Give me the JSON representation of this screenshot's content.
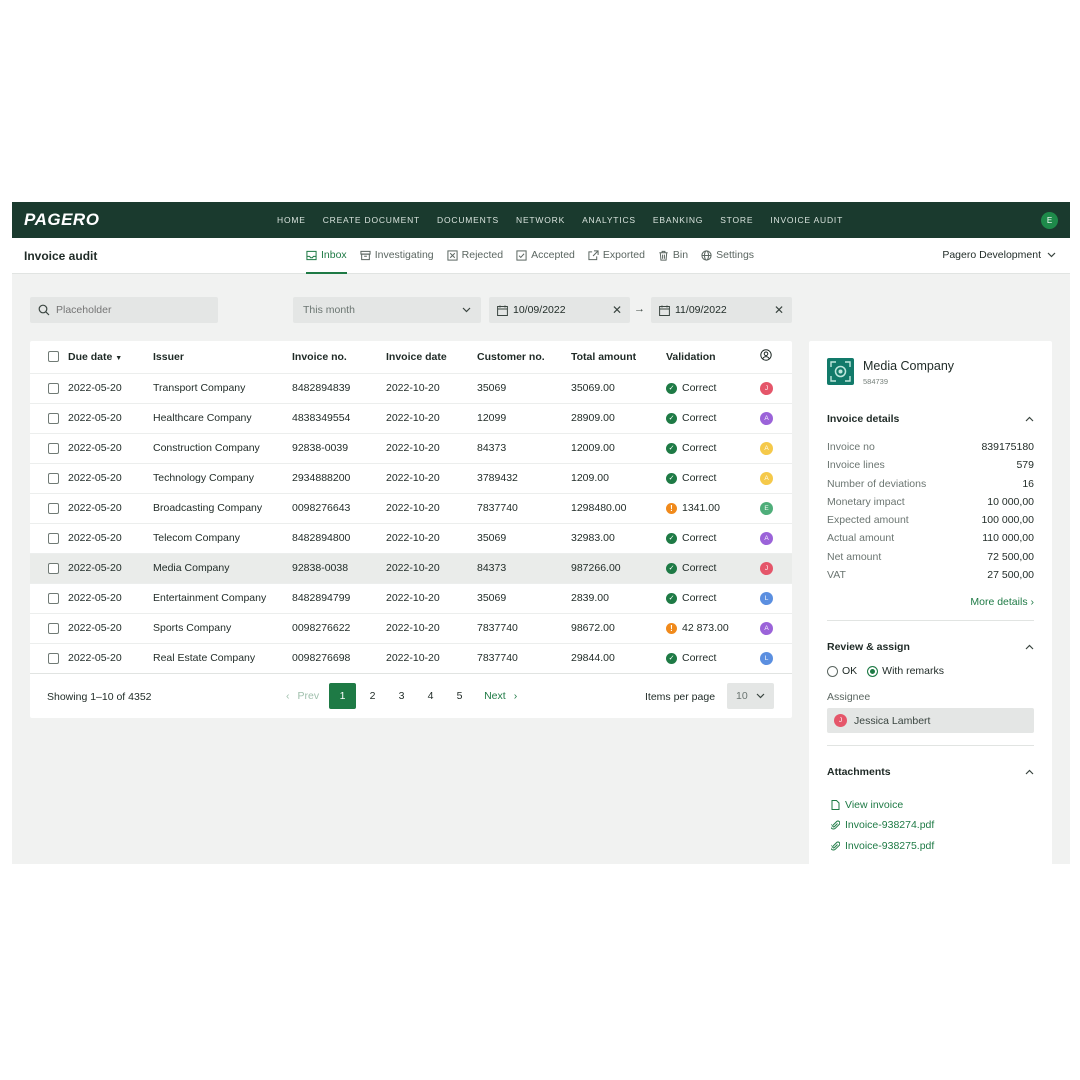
{
  "brand": "PAGERO",
  "nav": {
    "links": [
      "HOME",
      "CREATE DOCUMENT",
      "DOCUMENTS",
      "NETWORK",
      "ANALYTICS",
      "EBANKING",
      "STORE",
      "INVOICE AUDIT"
    ],
    "avatar": "E"
  },
  "subheader": {
    "title": "Invoice audit",
    "tabs": [
      "Inbox",
      "Investigating",
      "Rejected",
      "Accepted",
      "Exported",
      "Bin",
      "Settings"
    ],
    "active_tab": "Inbox",
    "org": "Pagero Development"
  },
  "filters": {
    "search_placeholder": "Placeholder",
    "period": "This month",
    "date_from": "10/09/2022",
    "date_to": "11/09/2022"
  },
  "table": {
    "headers": [
      "Due date",
      "Issuer",
      "Invoice no.",
      "Invoice date",
      "Customer no.",
      "Total amount",
      "Validation"
    ],
    "rows": [
      {
        "due": "2022-05-20",
        "issuer": "Transport Company",
        "invoice_no": "8482894839",
        "invoice_date": "2022-10-20",
        "customer": "35069",
        "total": "35069.00",
        "status": "ok",
        "validation": "Correct",
        "assignee": "J",
        "color": "#e5566a"
      },
      {
        "due": "2022-05-20",
        "issuer": "Healthcare Company",
        "invoice_no": "4838349554",
        "invoice_date": "2022-10-20",
        "customer": "12099",
        "total": "28909.00",
        "status": "ok",
        "validation": "Correct",
        "assignee": "A",
        "color": "#9b63d9"
      },
      {
        "due": "2022-05-20",
        "issuer": "Construction Company",
        "invoice_no": "92838-0039",
        "invoice_date": "2022-10-20",
        "customer": "84373",
        "total": "12009.00",
        "status": "ok",
        "validation": "Correct",
        "assignee": "A",
        "color": "#f5c94a"
      },
      {
        "due": "2022-05-20",
        "issuer": "Technology Company",
        "invoice_no": "2934888200",
        "invoice_date": "2022-10-20",
        "customer": "3789432",
        "total": "1209.00",
        "status": "ok",
        "validation": "Correct",
        "assignee": "A",
        "color": "#f5c94a"
      },
      {
        "due": "2022-05-20",
        "issuer": "Broadcasting Company",
        "invoice_no": "0098276643",
        "invoice_date": "2022-10-20",
        "customer": "7837740",
        "total": "1298480.00",
        "status": "warn",
        "validation": "1341.00",
        "assignee": "E",
        "color": "#4fae7a"
      },
      {
        "due": "2022-05-20",
        "issuer": "Telecom Company",
        "invoice_no": "8482894800",
        "invoice_date": "2022-10-20",
        "customer": "35069",
        "total": "32983.00",
        "status": "ok",
        "validation": "Correct",
        "assignee": "A",
        "color": "#9b63d9"
      },
      {
        "due": "2022-05-20",
        "issuer": "Media Company",
        "invoice_no": "92838-0038",
        "invoice_date": "2022-10-20",
        "customer": "84373",
        "total": "987266.00",
        "status": "ok",
        "validation": "Correct",
        "assignee": "J",
        "color": "#e5566a"
      },
      {
        "due": "2022-05-20",
        "issuer": "Entertainment Company",
        "invoice_no": "8482894799",
        "invoice_date": "2022-10-20",
        "customer": "35069",
        "total": "2839.00",
        "status": "ok",
        "validation": "Correct",
        "assignee": "L",
        "color": "#5b8fe0"
      },
      {
        "due": "2022-05-20",
        "issuer": "Sports Company",
        "invoice_no": "0098276622",
        "invoice_date": "2022-10-20",
        "customer": "7837740",
        "total": "98672.00",
        "status": "warn",
        "validation": "42 873.00",
        "assignee": "A",
        "color": "#9b63d9"
      },
      {
        "due": "2022-05-20",
        "issuer": "Real Estate Company",
        "invoice_no": "0098276698",
        "invoice_date": "2022-10-20",
        "customer": "7837740",
        "total": "29844.00",
        "status": "ok",
        "validation": "Correct",
        "assignee": "L",
        "color": "#5b8fe0"
      }
    ]
  },
  "pager": {
    "showing": "Showing 1–10 of 4352",
    "prev": "Prev",
    "next": "Next",
    "pages": [
      "1",
      "2",
      "3",
      "4",
      "5"
    ],
    "items_per_page_label": "Items per page",
    "items_per_page": "10"
  },
  "side": {
    "company": "Media Company",
    "company_id": "584739",
    "details_title": "Invoice details",
    "details": [
      {
        "k": "Invoice no",
        "v": "839175180"
      },
      {
        "k": "Invoice lines",
        "v": "579"
      },
      {
        "k": "Number of deviations",
        "v": "16"
      },
      {
        "k": "Monetary impact",
        "v": "10 000,00"
      },
      {
        "k": "Expected amount",
        "v": "100 000,00"
      },
      {
        "k": "Actual amount",
        "v": "110 000,00"
      },
      {
        "k": "Net amount",
        "v": "72 500,00"
      },
      {
        "k": "VAT",
        "v": "27 500,00"
      }
    ],
    "more": "More details",
    "review_title": "Review & assign",
    "radio_ok": "OK",
    "radio_remarks": "With remarks",
    "assignee_label": "Assignee",
    "assignee_initial": "J",
    "assignee_name": "Jessica Lambert",
    "attachments_title": "Attachments",
    "attachments": [
      "View invoice",
      "Invoice-938274.pdf",
      "Invoice-938275.pdf"
    ]
  },
  "colors": {
    "brand_dark": "#1a3a2e",
    "accent": "#1e7a45",
    "warning": "#f08a1c"
  }
}
